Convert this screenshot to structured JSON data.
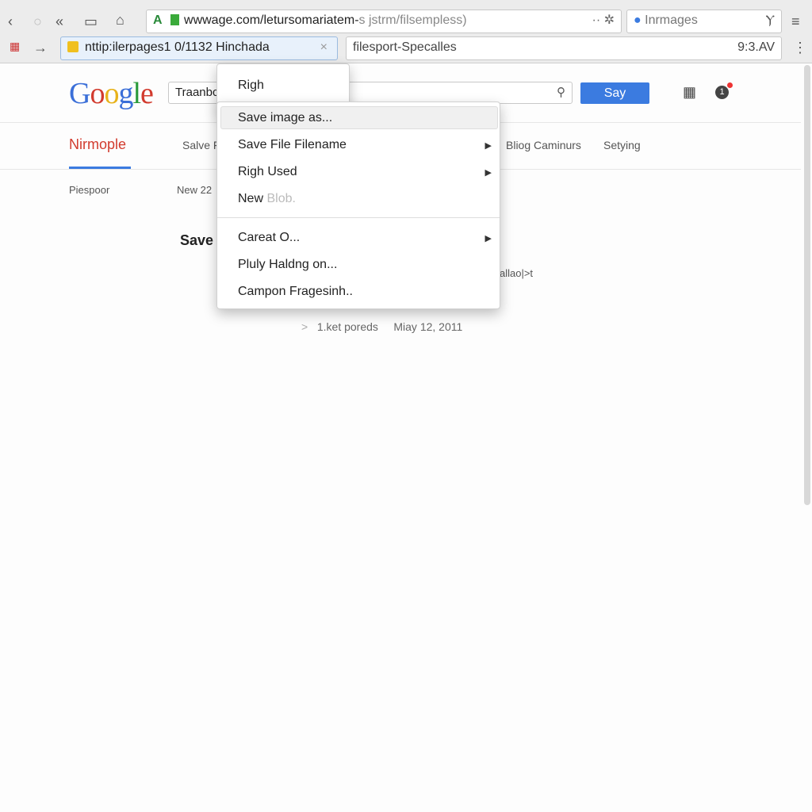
{
  "browser": {
    "address_url": "wwwage.com/letursomariatem-",
    "address_url_dim": "s jstrm/filsempless)",
    "search_box": "Inrmages",
    "tab_url": "nttip:ilerpages1 0/1132 Hinchada",
    "second_field": "filesport-Specalles",
    "time": "9:3.AV"
  },
  "page": {
    "logo": "Google",
    "search_value": "Traanbc",
    "search_button": "Say",
    "notification_count": "1",
    "tabs": [
      "Nirmople",
      "Salve F",
      "Bliog Caminurs",
      "Setying"
    ],
    "sub": [
      "Piespoor",
      "New 22"
    ],
    "heading": "Save I",
    "side_text": "allao|>t",
    "meta": [
      ">",
      "1.ket poreds",
      "Miay 12, 2011"
    ]
  },
  "context_menu": {
    "top_item": "Righ",
    "items": [
      {
        "label": "Save image as...",
        "highlighted": true
      },
      {
        "label": "Save File Filename",
        "submenu": true
      },
      {
        "label": "Righ Used",
        "submenu": true
      },
      {
        "label": "New",
        "dim": "Blob."
      },
      {
        "label": "Careat O...",
        "submenu": true
      },
      {
        "label": "Pluly Haldng on..."
      },
      {
        "label": "Campon Fragesinh.."
      }
    ]
  },
  "colors": {
    "accent": "#3b7be0",
    "tab_active": "#d23b2e"
  }
}
